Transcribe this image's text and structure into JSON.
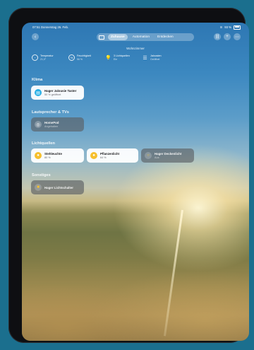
{
  "status": {
    "time": "07:51  Donnerstag 26. Feb.",
    "battery": "93 %"
  },
  "tabs": [
    {
      "label": "Zuhause",
      "active": true
    },
    {
      "label": "Automation",
      "active": false
    },
    {
      "label": "Entdecken",
      "active": false
    }
  ],
  "room": {
    "title": "Wohnzimmer"
  },
  "stats": [
    {
      "icon": "thermometer-icon",
      "label": "Temperatur",
      "value": "21,0°"
    },
    {
      "icon": "humidity-icon",
      "label": "Feuchtigkeit",
      "value": "56 %"
    },
    {
      "icon": "lightbulb-icon",
      "label": "3 Lichtquellen",
      "value": "Ein"
    },
    {
      "icon": "blinds-icon",
      "label": "Jalousien",
      "value": "Geöffnet"
    }
  ],
  "sections": {
    "klima": "Klima",
    "speakers": "Lautsprecher & TVs",
    "lights": "Lichtquellen",
    "other": "Sonstiges"
  },
  "tiles": {
    "blind": {
      "name": "Hager Jalousie Taster",
      "status": "50 % geöffnet"
    },
    "homepod": {
      "name": "HomePod",
      "status": "Angehalten"
    },
    "floor_lamp": {
      "name": "Stehleuchte",
      "status": "80 %"
    },
    "plant_light": {
      "name": "Pflanzenlicht",
      "status": "64 %"
    },
    "ceiling_light": {
      "name": "Hager Deckenlicht",
      "status": "Aus"
    },
    "light_switch": {
      "name": "Hager Lichtschalter",
      "status": ""
    }
  },
  "colors": {
    "accent_on": "#f6c02e",
    "blind_icon": "#29b0e6"
  }
}
